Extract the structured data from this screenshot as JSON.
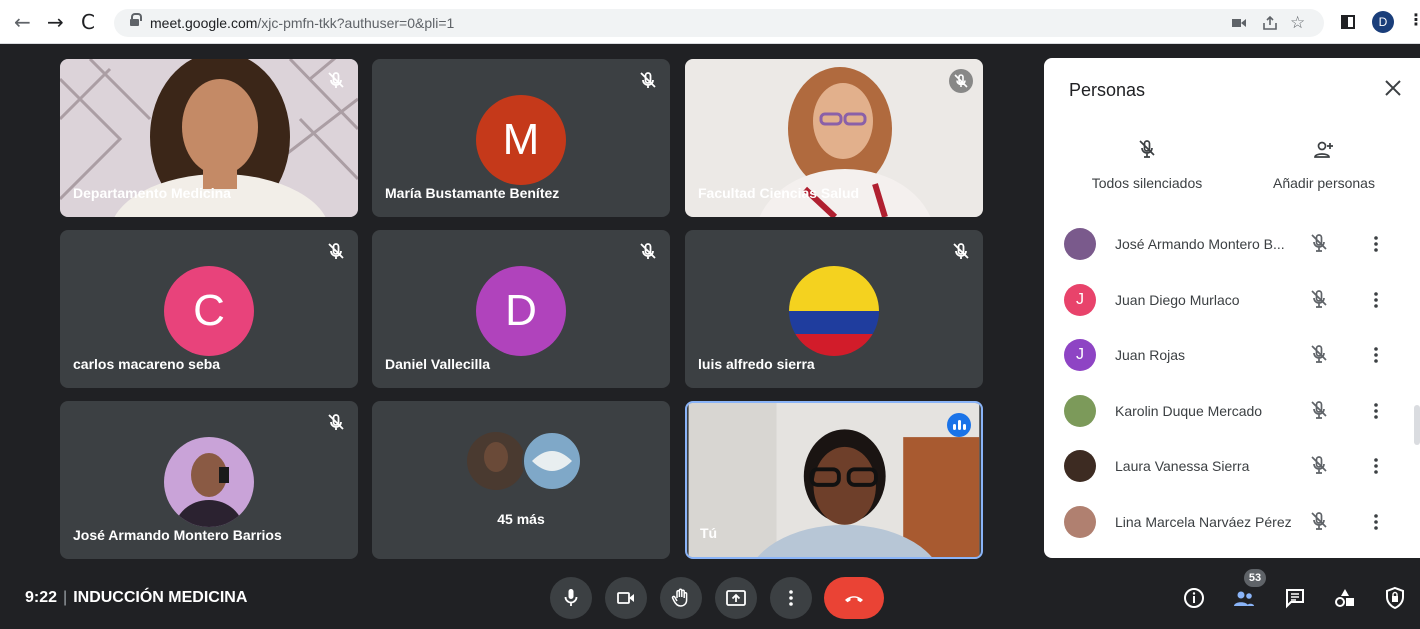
{
  "browser": {
    "url_host": "meet.google.com",
    "url_path": "/xjc-pmfn-tkk?authuser=0&pli=1",
    "profile_initial": "D"
  },
  "tiles": [
    {
      "name": "Departamento Medicina",
      "kind": "video"
    },
    {
      "name": "María Bustamante Benítez",
      "kind": "avatar",
      "initial": "M",
      "color": "#c5391a"
    },
    {
      "name": "Facultad Ciencias Salud",
      "kind": "video"
    },
    {
      "name": "carlos macareno seba",
      "kind": "avatar",
      "initial": "C",
      "color": "#e8437b"
    },
    {
      "name": "Daniel Vallecilla",
      "kind": "avatar",
      "initial": "D",
      "color": "#b043bc"
    },
    {
      "name": "luis alfredo sierra",
      "kind": "flag"
    },
    {
      "name": "José Armando Montero Barrios",
      "kind": "photo-avatar"
    },
    {
      "name": "",
      "kind": "overflow",
      "more_label": "45 más"
    },
    {
      "name": "Tú",
      "kind": "video-self"
    }
  ],
  "panel": {
    "title": "Personas",
    "actions": [
      {
        "label": "Todos silenciados",
        "icon": "mic-off-icon"
      },
      {
        "label": "Añadir personas",
        "icon": "person-add-icon"
      }
    ],
    "participants": [
      {
        "name": "José Armando Montero B...",
        "initial": "",
        "color": "#7a5a8c"
      },
      {
        "name": "Juan Diego Murlaco",
        "initial": "J",
        "color": "#e8436b"
      },
      {
        "name": "Juan Rojas",
        "initial": "J",
        "color": "#8e44c4"
      },
      {
        "name": "Karolin Duque Mercado",
        "initial": "",
        "color": "#7c9a5a"
      },
      {
        "name": "Laura Vanessa Sierra",
        "initial": "",
        "color": "#3d2b22"
      },
      {
        "name": "Lina Marcela Narváez Pérez",
        "initial": "",
        "color": "#b08070"
      }
    ]
  },
  "bottom": {
    "time": "9:22",
    "meeting_name": "INDUCCIÓN MEDICINA",
    "participant_count": "53"
  }
}
